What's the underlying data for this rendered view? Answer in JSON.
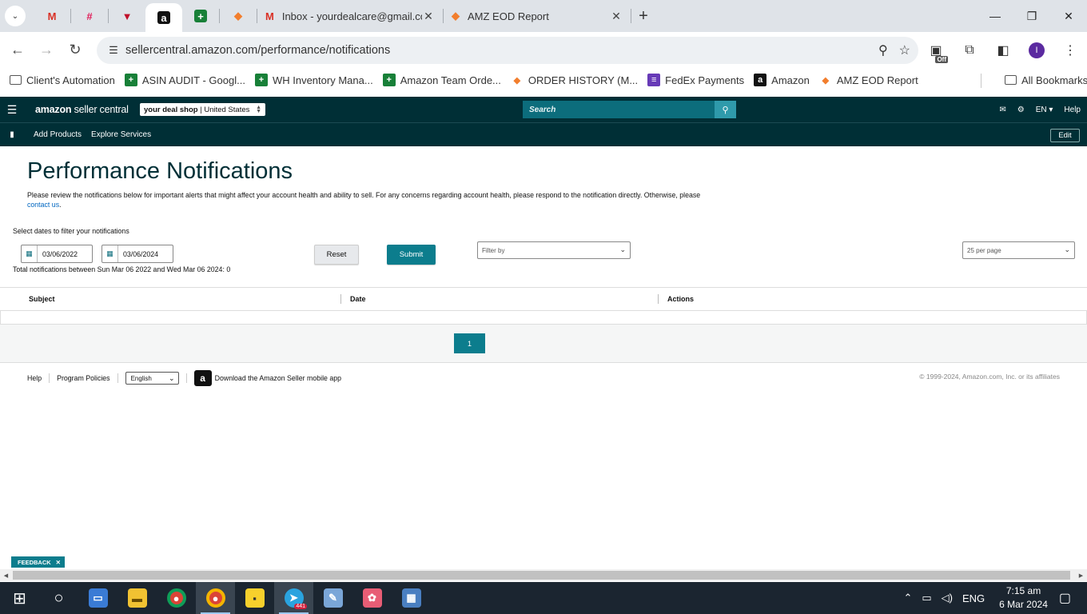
{
  "browser": {
    "tabs": [
      {
        "icon": "gmail-icon",
        "glyph": "M",
        "color": "#d93025"
      },
      {
        "icon": "slack-icon",
        "glyph": "#",
        "color": "#e01e5a"
      },
      {
        "icon": "vpn-icon",
        "glyph": "▼",
        "color": "#c0102a"
      },
      {
        "icon": "amazon-icon",
        "glyph": "a",
        "color": "#111111"
      },
      {
        "icon": "sheets-icon",
        "glyph": "+",
        "color": "#188038"
      },
      {
        "icon": "tool-icon",
        "glyph": "◆",
        "color": "#f27e2d"
      }
    ],
    "wide_tabs": [
      {
        "label": "Inbox - yourdealcare@gmail.com",
        "icon": "gmail-icon"
      },
      {
        "label": "AMZ EOD Report",
        "icon": "tool-icon"
      }
    ],
    "url": "sellercentral.amazon.com/performance/notifications",
    "avatar_letter": "I",
    "ext_badge": "Off"
  },
  "bookmarks": [
    {
      "label": "Client's Automation",
      "icon": "folder-icon"
    },
    {
      "label": "ASIN AUDIT - Googl...",
      "icon": "sheets-icon"
    },
    {
      "label": "WH Inventory Mana...",
      "icon": "sheets-icon"
    },
    {
      "label": "Amazon Team Orde...",
      "icon": "sheets-icon"
    },
    {
      "label": "ORDER HISTORY (M...",
      "icon": "tool-icon"
    },
    {
      "label": "FedEx Payments",
      "icon": "forms-icon"
    },
    {
      "label": "Amazon",
      "icon": "amazon-icon"
    },
    {
      "label": "AMZ EOD Report",
      "icon": "tool-icon"
    }
  ],
  "bookmarks_all": "All Bookmarks",
  "seller_central": {
    "logo_bold": "amazon",
    "logo_rest": " seller central",
    "store": "your deal shop",
    "marketplace": "United States",
    "search_placeholder": "Search",
    "lang": "EN",
    "help": "Help",
    "nav_links": [
      "Add Products",
      "Explore Services"
    ],
    "edit": "Edit"
  },
  "page": {
    "title": "Performance Notifications",
    "description": "Please review the notifications below for important alerts that might affect your account health and ability to sell. For any concerns regarding account health, please respond to the notification directly. Otherwise, please",
    "contact_link": "contact us",
    "filter_label": "Select dates to filter your notifications",
    "date_from": "03/06/2022",
    "date_to": "03/06/2024",
    "reset": "Reset",
    "submit": "Submit",
    "filter_placeholder": "Filter by",
    "per_page": "25 per page",
    "total_text": "Total notifications between Sun Mar 06 2022 and Wed Mar 06 2024: 0",
    "columns": [
      "Subject",
      "Date",
      "Actions"
    ],
    "current_page": "1"
  },
  "footer": {
    "help": "Help",
    "program_policies": "Program Policies",
    "language": "English",
    "app_text": "Download the Amazon Seller mobile app",
    "copyright": "© 1999-2024, Amazon.com, Inc. or its affiliates",
    "feedback": "FEEDBACK"
  },
  "taskbar": {
    "apps": [
      {
        "name": "start-icon",
        "color": "transparent",
        "glyph": "⊞"
      },
      {
        "name": "search-icon",
        "color": "transparent",
        "glyph": "○"
      },
      {
        "name": "laptop-icon",
        "color": "#3a7bd5",
        "glyph": "▭"
      },
      {
        "name": "file-explorer-icon",
        "color": "#f1c232",
        "glyph": "▬"
      },
      {
        "name": "chrome-icon",
        "color": "#db4437",
        "glyph": "●"
      },
      {
        "name": "chrome-profile-icon",
        "color": "#db4437",
        "glyph": "●"
      },
      {
        "name": "sticky-notes-icon",
        "color": "#f7d02c",
        "glyph": "▪"
      },
      {
        "name": "telegram-icon",
        "color": "#2aa3df",
        "glyph": "➤"
      },
      {
        "name": "paint-icon",
        "color": "#7aa6d8",
        "glyph": "✎"
      },
      {
        "name": "paint-3d-icon",
        "color": "#e85d75",
        "glyph": "✿"
      },
      {
        "name": "calculator-icon",
        "color": "#4a7fc1",
        "glyph": "▦"
      }
    ],
    "telegram_badge": "441",
    "lang": "ENG",
    "time": "7:15 am",
    "date": "6 Mar 2024"
  }
}
